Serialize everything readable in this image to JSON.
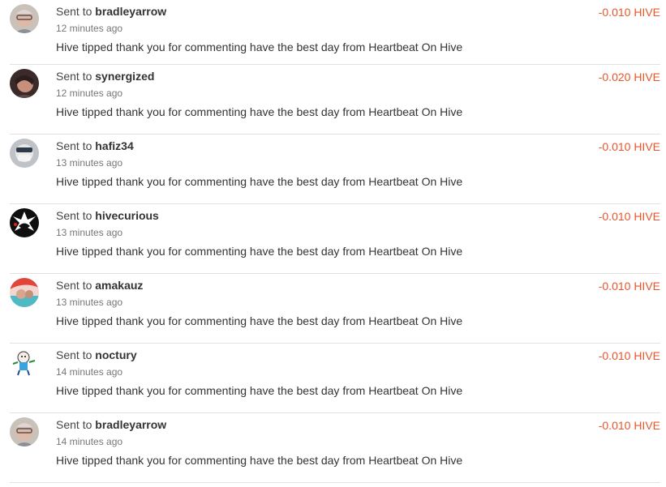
{
  "transfers": [
    {
      "prefix": "Sent to",
      "user": "bradleyarrow",
      "time": "12 minutes ago",
      "memo": "Hive tipped thank you for commenting have the best day from Heartbeat On Hive",
      "amount": "-0.010 HIVE",
      "avatar": "bradleyarrow-avatar"
    },
    {
      "prefix": "Sent to",
      "user": "synergized",
      "time": "12 minutes ago",
      "memo": "Hive tipped thank you for commenting have the best day from Heartbeat On Hive",
      "amount": "-0.020 HIVE",
      "avatar": "synergized-avatar"
    },
    {
      "prefix": "Sent to",
      "user": "hafiz34",
      "time": "13 minutes ago",
      "memo": "Hive tipped thank you for commenting have the best day from Heartbeat On Hive",
      "amount": "-0.010 HIVE",
      "avatar": "hafiz34-avatar"
    },
    {
      "prefix": "Sent to",
      "user": "hivecurious",
      "time": "13 minutes ago",
      "memo": "Hive tipped thank you for commenting have the best day from Heartbeat On Hive",
      "amount": "-0.010 HIVE",
      "avatar": "hivecurious-avatar"
    },
    {
      "prefix": "Sent to",
      "user": "amakauz",
      "time": "13 minutes ago",
      "memo": "Hive tipped thank you for commenting have the best day from Heartbeat On Hive",
      "amount": "-0.010 HIVE",
      "avatar": "amakauz-avatar"
    },
    {
      "prefix": "Sent to",
      "user": "noctury",
      "time": "14 minutes ago",
      "memo": "Hive tipped thank you for commenting have the best day from Heartbeat On Hive",
      "amount": "-0.010 HIVE",
      "avatar": "noctury-avatar"
    },
    {
      "prefix": "Sent to",
      "user": "bradleyarrow",
      "time": "14 minutes ago",
      "memo": "Hive tipped thank you for commenting have the best day from Heartbeat On Hive",
      "amount": "-0.010 HIVE",
      "avatar": "bradleyarrow-avatar"
    }
  ],
  "colors": {
    "amount": "#e8562a",
    "divider": "#e2e2e2"
  }
}
